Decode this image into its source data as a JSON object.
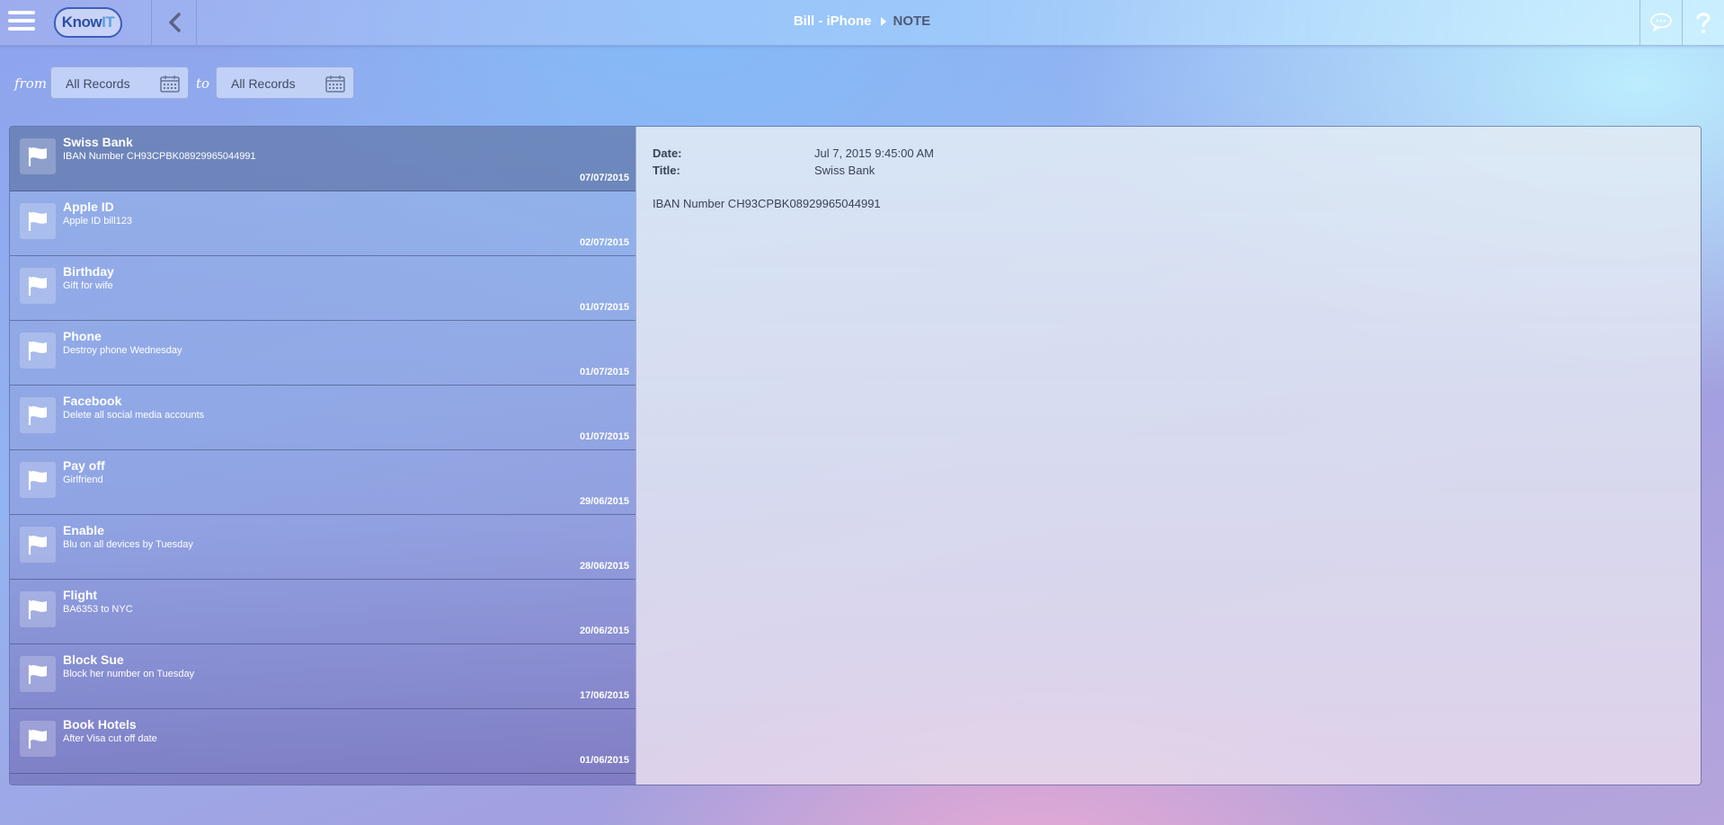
{
  "header": {
    "logo_text": "Know",
    "logo_text_accent": "IT",
    "device": "Bill - iPhone",
    "section": "NOTE",
    "icons": [
      "menu-icon",
      "back-icon",
      "chat-icon",
      "help-icon"
    ]
  },
  "filters": {
    "from_label": "from",
    "from_value": "All Records",
    "to_label": "to",
    "to_value": "All Records"
  },
  "notes": [
    {
      "title": "Swiss Bank",
      "subtitle": "IBAN Number CH93CPBK08929965044991",
      "date": "07/07/2015"
    },
    {
      "title": "Apple ID",
      "subtitle": "Apple ID bill123",
      "date": "02/07/2015"
    },
    {
      "title": "Birthday",
      "subtitle": "Gift for wife",
      "date": "01/07/2015"
    },
    {
      "title": "Phone",
      "subtitle": "Destroy phone Wednesday",
      "date": "01/07/2015"
    },
    {
      "title": "Facebook",
      "subtitle": "Delete all social media accounts",
      "date": "01/07/2015"
    },
    {
      "title": "Pay off",
      "subtitle": "Girlfriend",
      "date": "29/06/2015"
    },
    {
      "title": "Enable",
      "subtitle": "Blu on all devices by Tuesday",
      "date": "28/06/2015"
    },
    {
      "title": "Flight",
      "subtitle": "BA6353 to NYC",
      "date": "20/06/2015"
    },
    {
      "title": "Block Sue",
      "subtitle": "Block her number on Tuesday",
      "date": "17/06/2015"
    },
    {
      "title": "Book Hotels",
      "subtitle": "After Visa cut off date",
      "date": "01/06/2015"
    }
  ],
  "detail": {
    "date_label": "Date:",
    "date_value": "Jul 7, 2015 9:45:00 AM",
    "title_label": "Title:",
    "title_value": "Swiss Bank",
    "body": "IBAN Number CH93CPBK08929965044991"
  },
  "colors": {
    "active_row": "#5a6f99",
    "text_dark": "#3a4258",
    "logo_blue": "#2b4fa6"
  }
}
